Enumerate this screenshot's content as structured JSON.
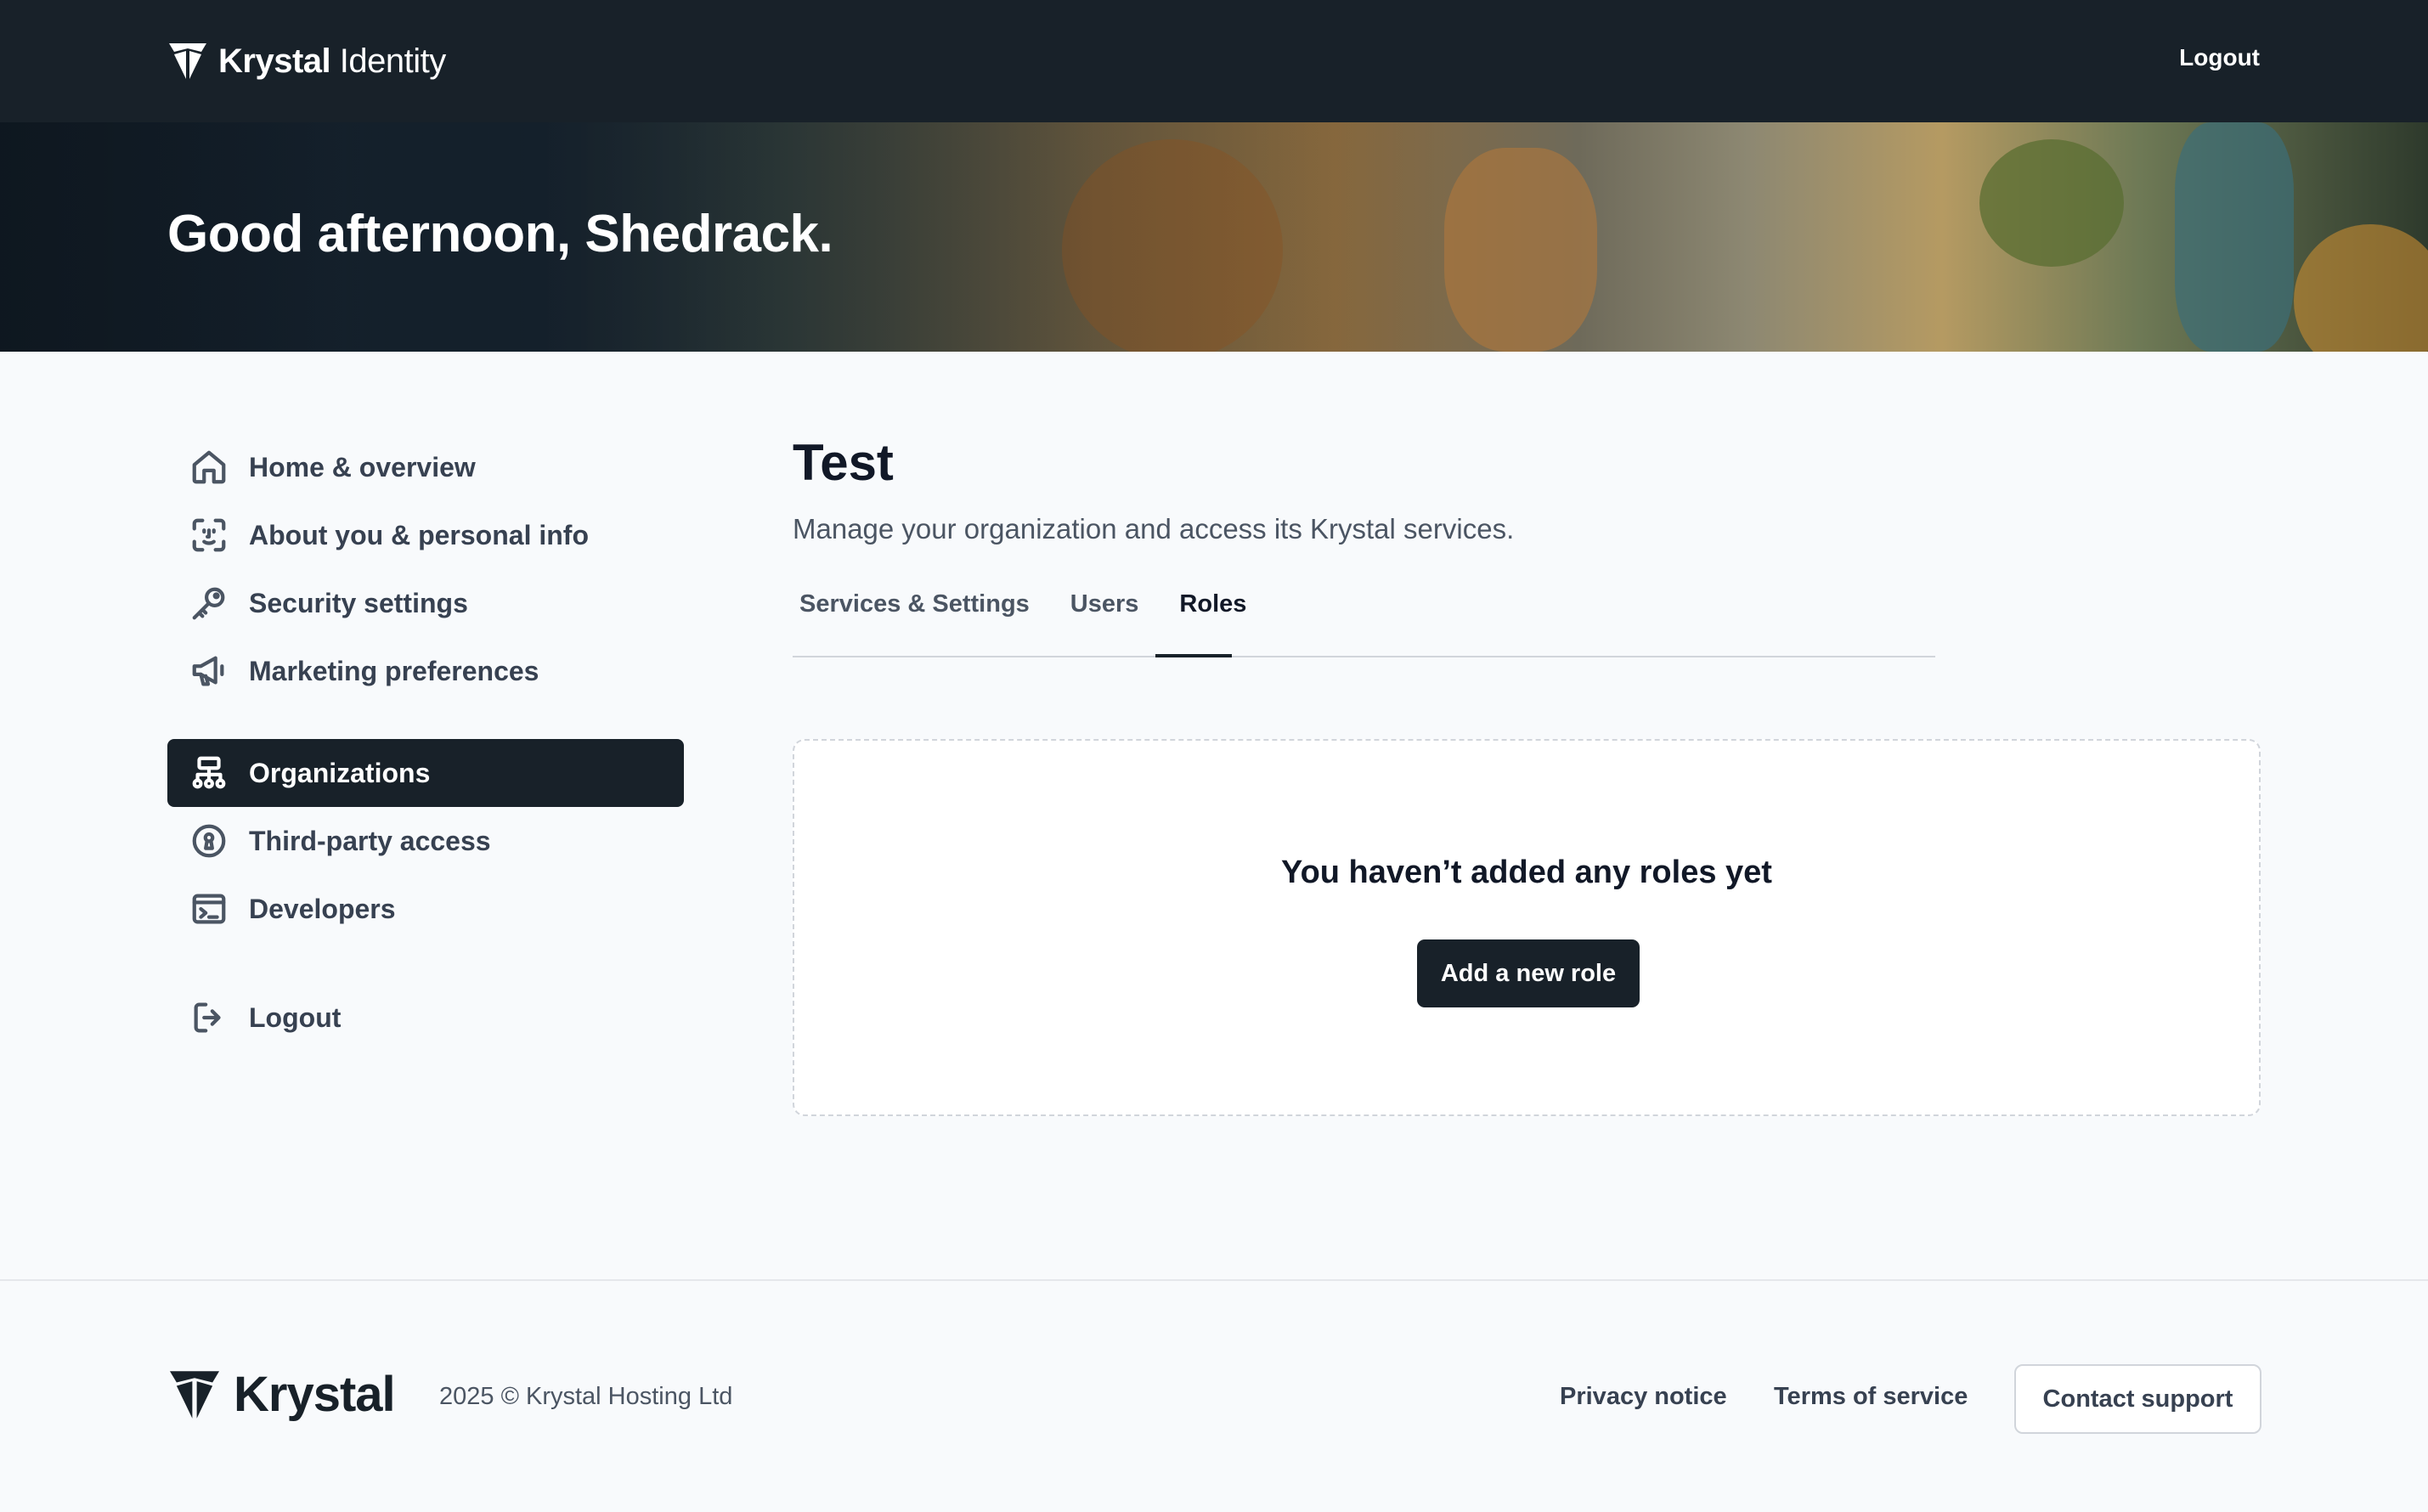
{
  "header": {
    "brand_bold": "Krystal",
    "brand_light": "Identity",
    "logout_label": "Logout"
  },
  "hero": {
    "greeting": "Good afternoon, Shedrack."
  },
  "sidebar": {
    "items": [
      {
        "label": "Home & overview",
        "icon": "home-icon"
      },
      {
        "label": "About you & personal info",
        "icon": "face-id-icon"
      },
      {
        "label": "Security settings",
        "icon": "key-icon"
      },
      {
        "label": "Marketing preferences",
        "icon": "megaphone-icon"
      },
      {
        "label": "Organizations",
        "icon": "org-chart-icon",
        "active": true
      },
      {
        "label": "Third-party access",
        "icon": "keyhole-icon"
      },
      {
        "label": "Developers",
        "icon": "terminal-icon"
      },
      {
        "label": "Logout",
        "icon": "logout-icon"
      }
    ]
  },
  "main": {
    "title": "Test",
    "subtitle": "Manage your organization and access its Krystal services.",
    "tabs": [
      {
        "label": "Services & Settings"
      },
      {
        "label": "Users"
      },
      {
        "label": "Roles",
        "active": true
      }
    ],
    "empty_state": {
      "message": "You haven’t added any roles yet",
      "button_label": "Add a new role"
    }
  },
  "footer": {
    "brand": "Krystal",
    "copyright": "2025 © Krystal Hosting Ltd",
    "privacy_label": "Privacy notice",
    "terms_label": "Terms of service",
    "contact_label": "Contact support"
  },
  "colors": {
    "dark": "#182129",
    "background": "#f8fafc",
    "border": "#d1d5db"
  }
}
